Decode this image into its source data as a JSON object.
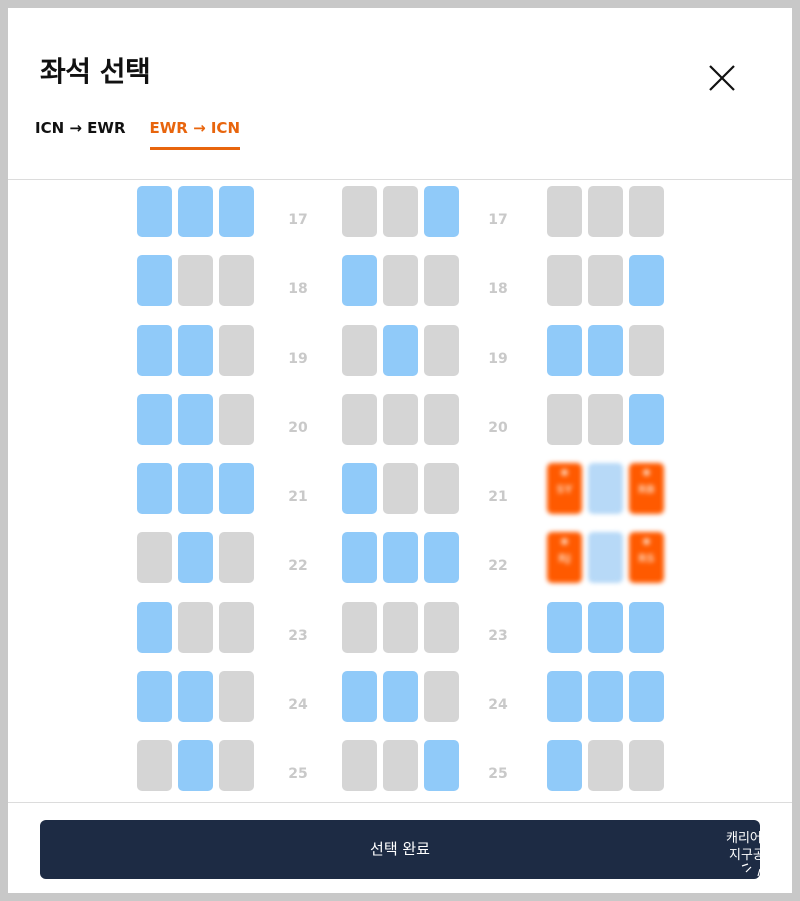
{
  "modal": {
    "title": "좌석 선택",
    "close_icon": "close-icon"
  },
  "tabs": [
    {
      "label": "ICN → EWR",
      "active": false
    },
    {
      "label": "EWR → ICN",
      "active": true
    }
  ],
  "seat_map": {
    "blocks": [
      "left",
      "middle",
      "right"
    ],
    "rows": [
      {
        "number": "17",
        "left": [
          "available",
          "available",
          "available"
        ],
        "middle": [
          "occupied",
          "occupied",
          "available"
        ],
        "right": [
          "occupied",
          "occupied",
          "occupied"
        ]
      },
      {
        "number": "18",
        "left": [
          "available",
          "occupied",
          "occupied"
        ],
        "middle": [
          "available",
          "occupied",
          "occupied"
        ],
        "right": [
          "occupied",
          "occupied",
          "available"
        ]
      },
      {
        "number": "19",
        "left": [
          "available",
          "available",
          "occupied"
        ],
        "middle": [
          "occupied",
          "available",
          "occupied"
        ],
        "right": [
          "available",
          "available",
          "occupied"
        ]
      },
      {
        "number": "20",
        "left": [
          "available",
          "available",
          "occupied"
        ],
        "middle": [
          "occupied",
          "occupied",
          "occupied"
        ],
        "right": [
          "occupied",
          "occupied",
          "available"
        ]
      },
      {
        "number": "21",
        "left": [
          "available",
          "available",
          "available"
        ],
        "middle": [
          "available",
          "occupied",
          "occupied"
        ],
        "right": [
          "selected",
          "pending",
          "selected"
        ]
      },
      {
        "number": "22",
        "left": [
          "occupied",
          "available",
          "occupied"
        ],
        "middle": [
          "available",
          "available",
          "available"
        ],
        "right": [
          "selected",
          "pending",
          "selected"
        ]
      },
      {
        "number": "23",
        "left": [
          "available",
          "occupied",
          "occupied"
        ],
        "middle": [
          "occupied",
          "occupied",
          "occupied"
        ],
        "right": [
          "available",
          "available",
          "available"
        ]
      },
      {
        "number": "24",
        "left": [
          "available",
          "available",
          "occupied"
        ],
        "middle": [
          "available",
          "available",
          "occupied"
        ],
        "right": [
          "available",
          "available",
          "available"
        ]
      },
      {
        "number": "25",
        "left": [
          "occupied",
          "available",
          "occupied"
        ],
        "middle": [
          "occupied",
          "occupied",
          "available"
        ],
        "right": [
          "available",
          "occupied",
          "occupied"
        ]
      }
    ],
    "selected_tags": {
      "21": [
        "SY",
        "",
        "RB"
      ],
      "22": [
        "RJ",
        "",
        "RS"
      ]
    },
    "colors": {
      "available": "#90caf9",
      "occupied": "#d5d5d5",
      "selected": "#ff5a00",
      "accent": "#e8650d",
      "button": "#1d2b44"
    }
  },
  "footer": {
    "confirm_label": "선택 완료"
  },
  "widget": {
    "line1": "캐리어",
    "line2": "지구공"
  }
}
